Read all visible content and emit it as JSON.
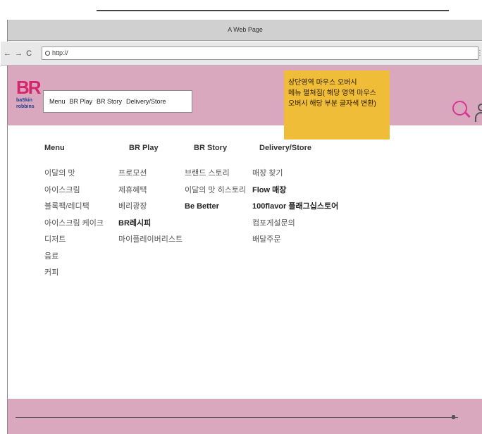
{
  "window": {
    "title": "A Web Page"
  },
  "address_bar": {
    "nav_glyphs": "← → C",
    "url": "http://"
  },
  "brand": {
    "mark": "BR",
    "name_lines": [
      "baSkin",
      "robbins"
    ]
  },
  "top_nav": {
    "items": [
      "Menu",
      "BR Play",
      "BR Story",
      "Delivery/Store"
    ]
  },
  "annotation": {
    "lines": [
      "상단영역 마우스 오버시",
      "메뉴 펼쳐짐( 해당 영역 마우스",
      "오버시 해당 부분 글자색 변환)"
    ],
    "color": "#f0bd38"
  },
  "mega_menu": {
    "columns": [
      {
        "heading": "Menu",
        "items": [
          "이달의 맛",
          "아이스크림",
          "블록팩/레디팩",
          "아이스크림 케이크",
          "디저트",
          "음료",
          "커피"
        ]
      },
      {
        "heading": "BR Play",
        "items": [
          "프로모션",
          "제휴혜택",
          "베리광장",
          "BR레시피",
          "마이플레이버리스트"
        ]
      },
      {
        "heading": "BR Story",
        "items": [
          "브랜드 스토리",
          "이달의 맛 히스토리",
          "Be Better"
        ]
      },
      {
        "heading": "Delivery/Store",
        "items": [
          "매장 찾기",
          "Flow 매장",
          "100flavor 플래그십스토어",
          "컴포게설문의",
          "배달주문"
        ]
      }
    ]
  },
  "colors": {
    "header_bg": "#d9a7be",
    "brand_pink": "#d6246e",
    "search_pink": "#d8368f"
  }
}
